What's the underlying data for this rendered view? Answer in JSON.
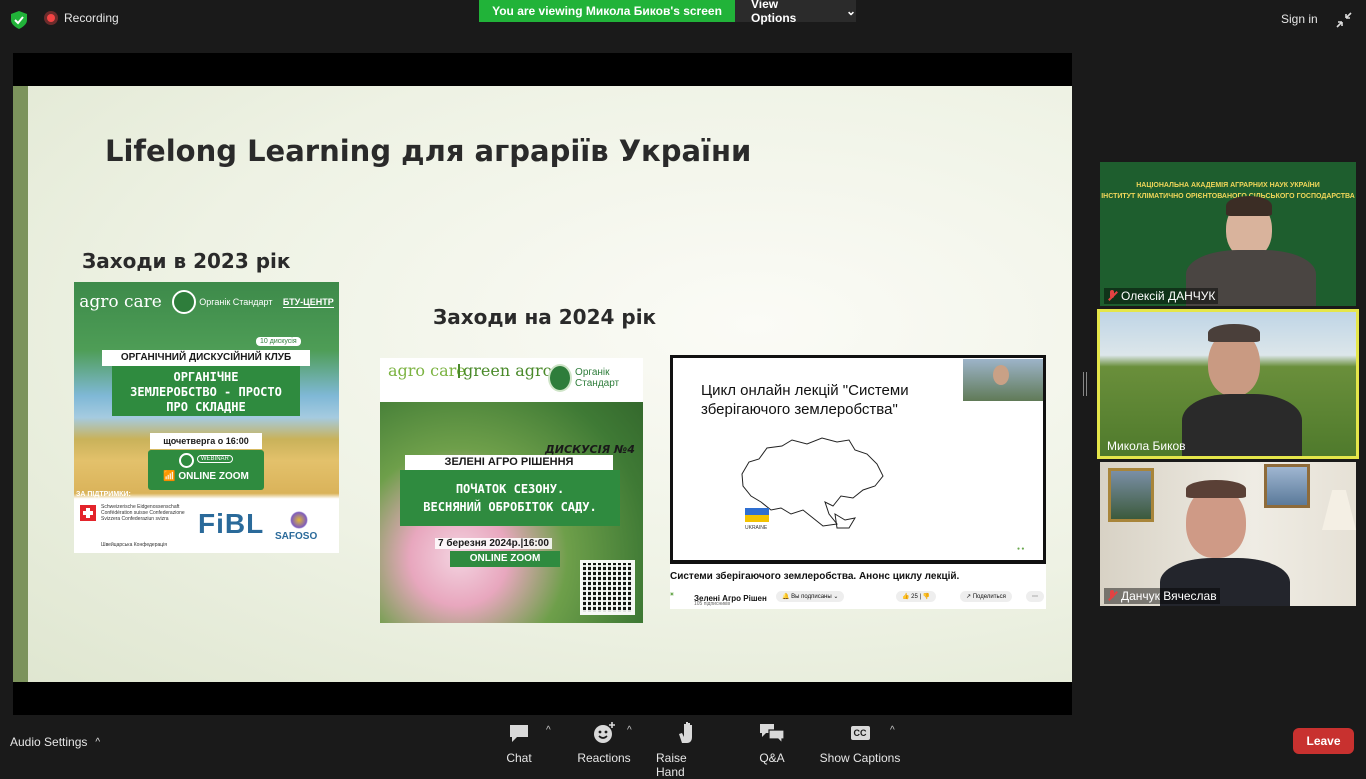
{
  "topbar": {
    "recording_label": "Recording",
    "viewing_label": "You are viewing Микола Биков's screen",
    "view_options_label": "View Options",
    "sign_in_label": "Sign in"
  },
  "slide": {
    "title": "Lifelong Learning для аграріїв України",
    "heading_2023": "Заходи в 2023 рік",
    "heading_2024": "Заходи на 2024 рік"
  },
  "poster1": {
    "brand_agro": "agro care",
    "brand_organic": "Органік Стандарт",
    "brand_btu": "БТУ-ЦЕНТР",
    "tag": "10 дискусія",
    "club": "ОРГАНІЧНИЙ ДИСКУСІЙНИЙ КЛУБ",
    "topic_line1": "ОРГАНІЧНЕ",
    "topic_line2": "ЗЕМЛЕРОБСТВО - ПРОСТО",
    "topic_line3": "ПРО СКЛАДНЕ",
    "when": "щочетверга о 16:00",
    "webinar": "WEBINAR",
    "zoom": "ONLINE ZOOM",
    "support": "ЗА ПІДТРИМКИ:",
    "swiss_text": "Schweizerische Eidgenossenschaft Confédération suisse Confederazione Svizzera Confederaziun svizra",
    "swiss_ua": "Швейцарська Конфедерація",
    "fibl": "FiBL",
    "safoso": "SAFOSO"
  },
  "poster2": {
    "brand_agro": "agro care",
    "brand_green": "green agro",
    "brand_organic": "Органік Стандарт",
    "discussion": "ДИСКУСІЯ №4",
    "title": "ЗЕЛЕНІ АГРО РІШЕННЯ",
    "topic_line1": "ПОЧАТОК СЕЗОНУ.",
    "topic_line2": "ВЕСНЯНИЙ ОБРОБІТОК САДУ.",
    "date": "7 березня 2024р.|16:00",
    "zoom": "ONLINE ZOOM"
  },
  "video": {
    "title_line1": "Цикл онлайн лекцій \"Системи",
    "title_line2": "зберігаючого землеробства\"",
    "ukraine_label": "UKRAINE",
    "caption": "Системи зберігаючого землеробства. Анонс циклу лекцій.",
    "channel": "Зелені Агро Рішен",
    "subscribers": "105 підписників",
    "subscribed": "Вы подписаны",
    "likes": "25",
    "share": "Поделиться"
  },
  "participants": [
    {
      "name": "Олексій ДАНЧУК",
      "muted": true,
      "banner_line1": "НАЦІОНАЛЬНА АКАДЕМІЯ АГРАРНИХ НАУК УКРАЇНИ",
      "banner_line2": "ІНСТИТУТ КЛІМАТИЧНО ОРІЄНТОВАНОГО СІЛЬСЬКОГО ГОСПОДАРСТВА"
    },
    {
      "name": "Микола Биков",
      "muted": false,
      "active": true
    },
    {
      "name": "Данчук Вячеслав",
      "muted": true
    }
  ],
  "toolbar": {
    "audio_settings": "Audio Settings",
    "chat": "Chat",
    "reactions": "Reactions",
    "raise_hand": "Raise Hand",
    "qa": "Q&A",
    "show_captions": "Show Captions",
    "cc": "CC",
    "leave": "Leave"
  },
  "colors": {
    "viewing_banner": "#21b339",
    "leave_button": "#c8312f",
    "active_speaker": "#e5e64a"
  }
}
